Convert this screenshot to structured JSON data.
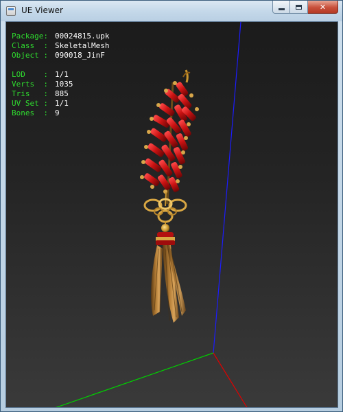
{
  "window": {
    "title": "UE Viewer",
    "minimize_icon": "minimize-icon",
    "maximize_icon": "maximize-icon",
    "close_icon": "close-icon",
    "close_glyph": "✕"
  },
  "info": {
    "mesh_info": [
      {
        "label": "Package",
        "value": "00024815.upk"
      },
      {
        "label": "Class  ",
        "value": "SkeletalMesh"
      },
      {
        "label": "Object ",
        "value": "090018_JinF"
      }
    ],
    "stats": [
      {
        "label": "LOD    ",
        "value": "1/1"
      },
      {
        "label": "Verts  ",
        "value": "1035"
      },
      {
        "label": "Tris   ",
        "value": "885"
      },
      {
        "label": "UV Set ",
        "value": "1/1"
      },
      {
        "label": "Bones  ",
        "value": "9"
      }
    ],
    "separator": ": "
  },
  "colors": {
    "label": "#2fdc2f",
    "value": "#ffffff",
    "axis_x": "#e00000",
    "axis_y": "#00d000",
    "axis_z": "#1c1cff",
    "firecracker_red": "#c81212",
    "gold": "#c9952e",
    "tassel": "#9a6a2c"
  }
}
